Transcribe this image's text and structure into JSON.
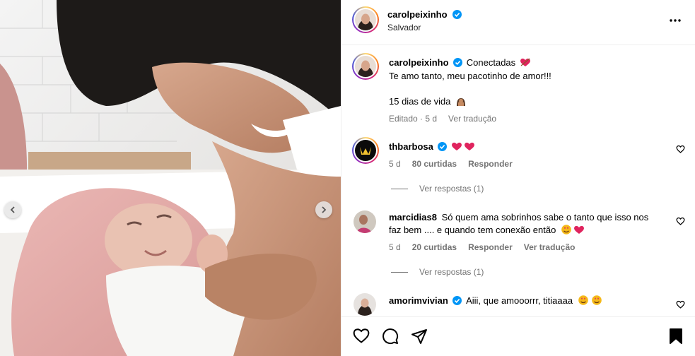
{
  "post": {
    "author": "carolpeixinho",
    "location": "Salvador",
    "caption_author": "carolpeixinho",
    "caption_title": "Conectadas",
    "caption_line1": "Te amo tanto, meu pacotinho de amor!!!",
    "caption_line2": "15 dias de vida",
    "caption_edited": "Editado · 5 d",
    "caption_translate": "Ver tradução"
  },
  "comments": [
    {
      "username": "thbarbosa",
      "verified": true,
      "text": "",
      "age": "5 d",
      "likes": "80 curtidas",
      "reply": "Responder",
      "view_replies": "Ver respostas (1)"
    },
    {
      "username": "marcidias8",
      "verified": false,
      "text_line1": "Só quem ama sobrinhos sabe o tanto que isso nos",
      "text_line2": "faz bem .... e quando tem conexão então",
      "age": "5 d",
      "likes": "20 curtidas",
      "reply": "Responder",
      "translate": "Ver tradução",
      "view_replies": "Ver respostas (1)"
    },
    {
      "username": "amorimvivian",
      "verified": true,
      "text": "Aiii, que amooorrr, titiaaaa"
    }
  ],
  "icons": {
    "verified": "verified-badge-icon",
    "more": "more-options-icon",
    "like": "heart-icon",
    "comment": "comment-icon",
    "share": "share-icon",
    "save": "bookmark-icon",
    "prev": "chevron-left-icon",
    "next": "chevron-right-icon"
  },
  "colors": {
    "verified_blue": "#0095f6",
    "muted_text": "#737373",
    "heart_red": "#e0245e"
  }
}
